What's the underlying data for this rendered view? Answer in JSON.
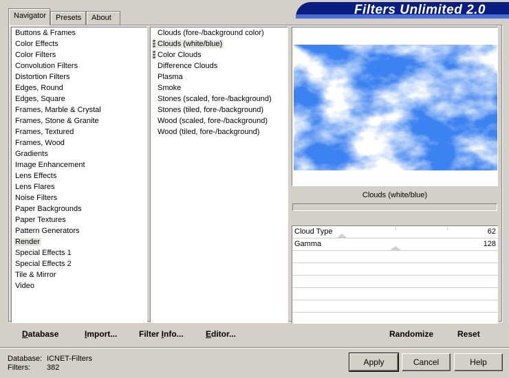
{
  "header": {
    "title": "Filters Unlimited 2.0"
  },
  "tabs": [
    {
      "label": "Navigator",
      "active": true
    },
    {
      "label": "Presets",
      "active": false
    },
    {
      "label": "About",
      "active": false
    }
  ],
  "categories": {
    "selected": "Render",
    "items": [
      "Buttons & Frames",
      "Color Effects",
      "Color Filters",
      "Convolution Filters",
      "Distortion Filters",
      "Edges, Round",
      "Edges, Square",
      "Frames, Marble & Crystal",
      "Frames, Stone & Granite",
      "Frames, Textured",
      "Frames, Wood",
      "Gradients",
      "Image Enhancement",
      "Lens Effects",
      "Lens Flares",
      "Noise Filters",
      "Paper Backgrounds",
      "Paper Textures",
      "Pattern Generators",
      "Render",
      "Special Effects 1",
      "Special Effects 2",
      "Tile & Mirror",
      "Video"
    ]
  },
  "filters": {
    "selected": "Clouds (white/blue)",
    "items": [
      {
        "label": "Clouds (fore-/background color)",
        "marked": false
      },
      {
        "label": "Clouds (white/blue)",
        "marked": true
      },
      {
        "label": "Color Clouds",
        "marked": true
      },
      {
        "label": "Difference Clouds",
        "marked": false
      },
      {
        "label": "Plasma",
        "marked": false
      },
      {
        "label": "Smoke",
        "marked": false
      },
      {
        "label": "Stones (scaled, fore-/background)",
        "marked": false
      },
      {
        "label": "Stones (tiled, fore-/background)",
        "marked": false
      },
      {
        "label": "Wood (scaled, fore-/background)",
        "marked": false
      },
      {
        "label": "Wood (tiled, fore-/background)",
        "marked": false
      }
    ]
  },
  "preview": {
    "caption": "Clouds (white/blue)",
    "colors": {
      "sky": "#3c82f0",
      "cloud": "#ffffff"
    }
  },
  "controls": [
    {
      "label": "Cloud Type",
      "value": 62,
      "max": 255
    },
    {
      "label": "Gamma",
      "value": 128,
      "max": 255
    }
  ],
  "toolbar": {
    "database": {
      "u": "D",
      "rest": "atabase"
    },
    "import": {
      "u": "I",
      "rest": "mport..."
    },
    "filter_info": {
      "pre": "Filter ",
      "u": "I",
      "rest": "nfo..."
    },
    "editor": {
      "u": "E",
      "rest": "ditor..."
    },
    "randomize": "Randomize",
    "reset": "Reset"
  },
  "info": {
    "database_label": "Database:",
    "database_value": "ICNET-Filters",
    "filters_label": "Filters:",
    "filters_value": "382"
  },
  "buttons": {
    "apply": "Apply",
    "cancel": "Cancel",
    "help": "Help"
  }
}
